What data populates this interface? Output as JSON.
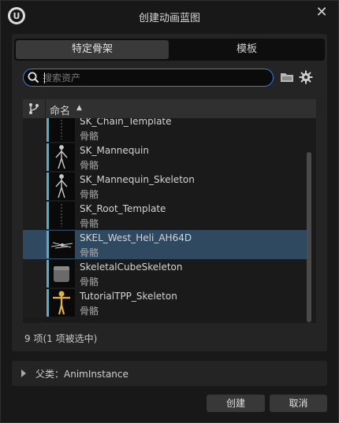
{
  "window": {
    "title": "创建动画蓝图"
  },
  "tabs": [
    {
      "label": "特定骨架",
      "active": true
    },
    {
      "label": "模板",
      "active": false
    }
  ],
  "search": {
    "placeholder": "搜索资产",
    "value": ""
  },
  "list": {
    "header_name": "命名",
    "header_sort_glyph": "▲",
    "items": [
      {
        "name": "SK_Chain_Template",
        "type": "骨骼",
        "selected": false
      },
      {
        "name": "SK_Mannequin",
        "type": "骨骼",
        "selected": false
      },
      {
        "name": "SK_Mannequin_Skeleton",
        "type": "骨骼",
        "selected": false
      },
      {
        "name": "SK_Root_Template",
        "type": "骨骼",
        "selected": false
      },
      {
        "name": "SKEL_West_Heli_AH64D",
        "type": "骨骼",
        "selected": true
      },
      {
        "name": "SkeletalCubeSkeleton",
        "type": "骨骼",
        "selected": false
      },
      {
        "name": "TutorialTPP_Skeleton",
        "type": "骨骼",
        "selected": false
      }
    ]
  },
  "status": {
    "text": "9 项(1 项被选中)"
  },
  "parent_class": {
    "label": "父类：AnimInstance"
  },
  "buttons": {
    "create": "创建",
    "cancel": "取消"
  },
  "colors": {
    "accent": "#2f7fd6",
    "selection": "#2f4961",
    "thumb_edge": "#41b8d2"
  }
}
